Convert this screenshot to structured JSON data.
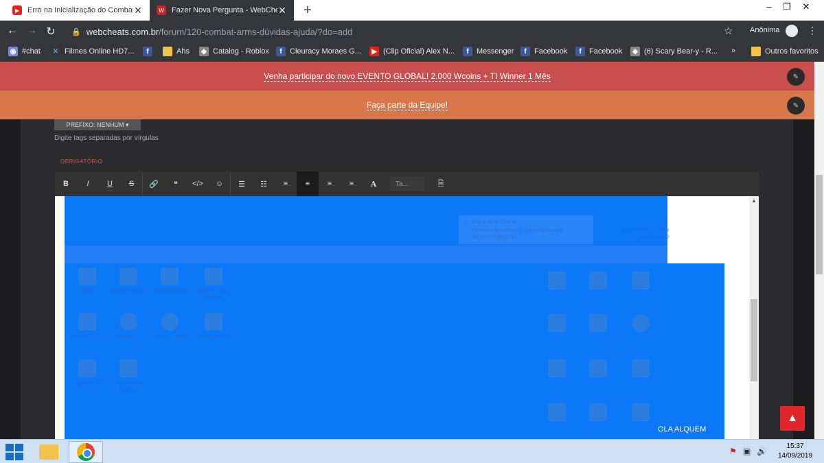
{
  "browser": {
    "tabs": [
      {
        "title": "Erro na Inicialização do Combat a",
        "close": "✕",
        "favicon": "youtube-icon"
      },
      {
        "title": "Fazer Nova Pergunta - WebCheat",
        "close": "✕",
        "favicon": "webcheats-icon"
      }
    ],
    "new_tab": "+",
    "window_controls": {
      "minimize": "–",
      "maximize": "❐",
      "close": "✕"
    },
    "nav": {
      "back": "←",
      "forward": "→",
      "reload": "↻"
    },
    "address": {
      "host": "webcheats.com.br",
      "path": "/forum/120-combat-arms-dúvidas-ajuda/?do=add"
    },
    "star": "☆",
    "profile_label": "Anônima",
    "menu": "⋮",
    "bookmarks": [
      {
        "label": "#chat",
        "icon": "discord-icon",
        "color": "#7289da"
      },
      {
        "label": "Filmes Online HD7...",
        "icon": "x-icon",
        "color": "#4ba0e8"
      },
      {
        "label": "",
        "icon": "facebook-icon",
        "color": "#3b5998"
      },
      {
        "label": "Ahs",
        "icon": "folder-icon",
        "color": "#f1c24c"
      },
      {
        "label": "Catalog - Roblox",
        "icon": "roblox-icon",
        "color": "#888888"
      },
      {
        "label": "Cleuracy Moraes G...",
        "icon": "facebook-icon",
        "color": "#3b5998"
      },
      {
        "label": "(Clip Oficial) Alex N...",
        "icon": "youtube-icon",
        "color": "#e62117"
      },
      {
        "label": "Messenger",
        "icon": "facebook-icon",
        "color": "#3b5998"
      },
      {
        "label": "Facebook",
        "icon": "facebook-icon",
        "color": "#3b5998"
      },
      {
        "label": "Facebook",
        "icon": "facebook-icon",
        "color": "#3b5998"
      },
      {
        "label": "(6) Scary Bear-y - R...",
        "icon": "roblox-icon",
        "color": "#888888"
      },
      {
        "label": "»",
        "icon": "",
        "color": ""
      },
      {
        "label": "Outros favoritos",
        "icon": "folder-icon",
        "color": "#f1c24c"
      }
    ]
  },
  "page": {
    "notice1": "Venha participar do novo EVENTO GLOBAL! 2.000 Wcoins + TI Winner 1 Mês",
    "notice2": "Faça parte da Equipe!",
    "notice_btn": "✎",
    "prefix_button": "PREFIXO: NENHUM ▾",
    "tags_hint": "Digite tags separadas por vírgulas",
    "required_label": "OBRIGATÓRIO",
    "toolbar": {
      "bold": "B",
      "italic": "I",
      "underline": "U",
      "strike": "S",
      "link": "🔗",
      "quote": "❝",
      "code": "</>",
      "emoji": "☺",
      "bullet_list": "☰",
      "numbered_list": "☷",
      "align_center": "≡",
      "align_left": "≡",
      "align_right": "≡",
      "justify": "≡",
      "font_color": "A",
      "font_size_placeholder": "Ta...",
      "source": "🗎"
    },
    "editor": {
      "eac_title": "Easy Anti-Cheat",
      "eac_message": "Unknown file version (C:\\Level Up\\Combat Arms\\nmcogame.dll)",
      "watermark": "Windows 8.1 Pro Build 9600",
      "desktop_icons": [
        "Lixeira",
        "Roblox Player",
        "Malwarebytes",
        "Wise Game Booster",
        "Roblox Studio",
        "Bandicam",
        "IObit Uninstaller",
        "Combat Arms",
        "CrossFire BR",
        "CrossFire BR Installer"
      ],
      "caption": "OLA ALQUEM"
    },
    "scroll_top": "▲"
  },
  "taskbar": {
    "time": "15:37",
    "date": "14/09/2019"
  }
}
